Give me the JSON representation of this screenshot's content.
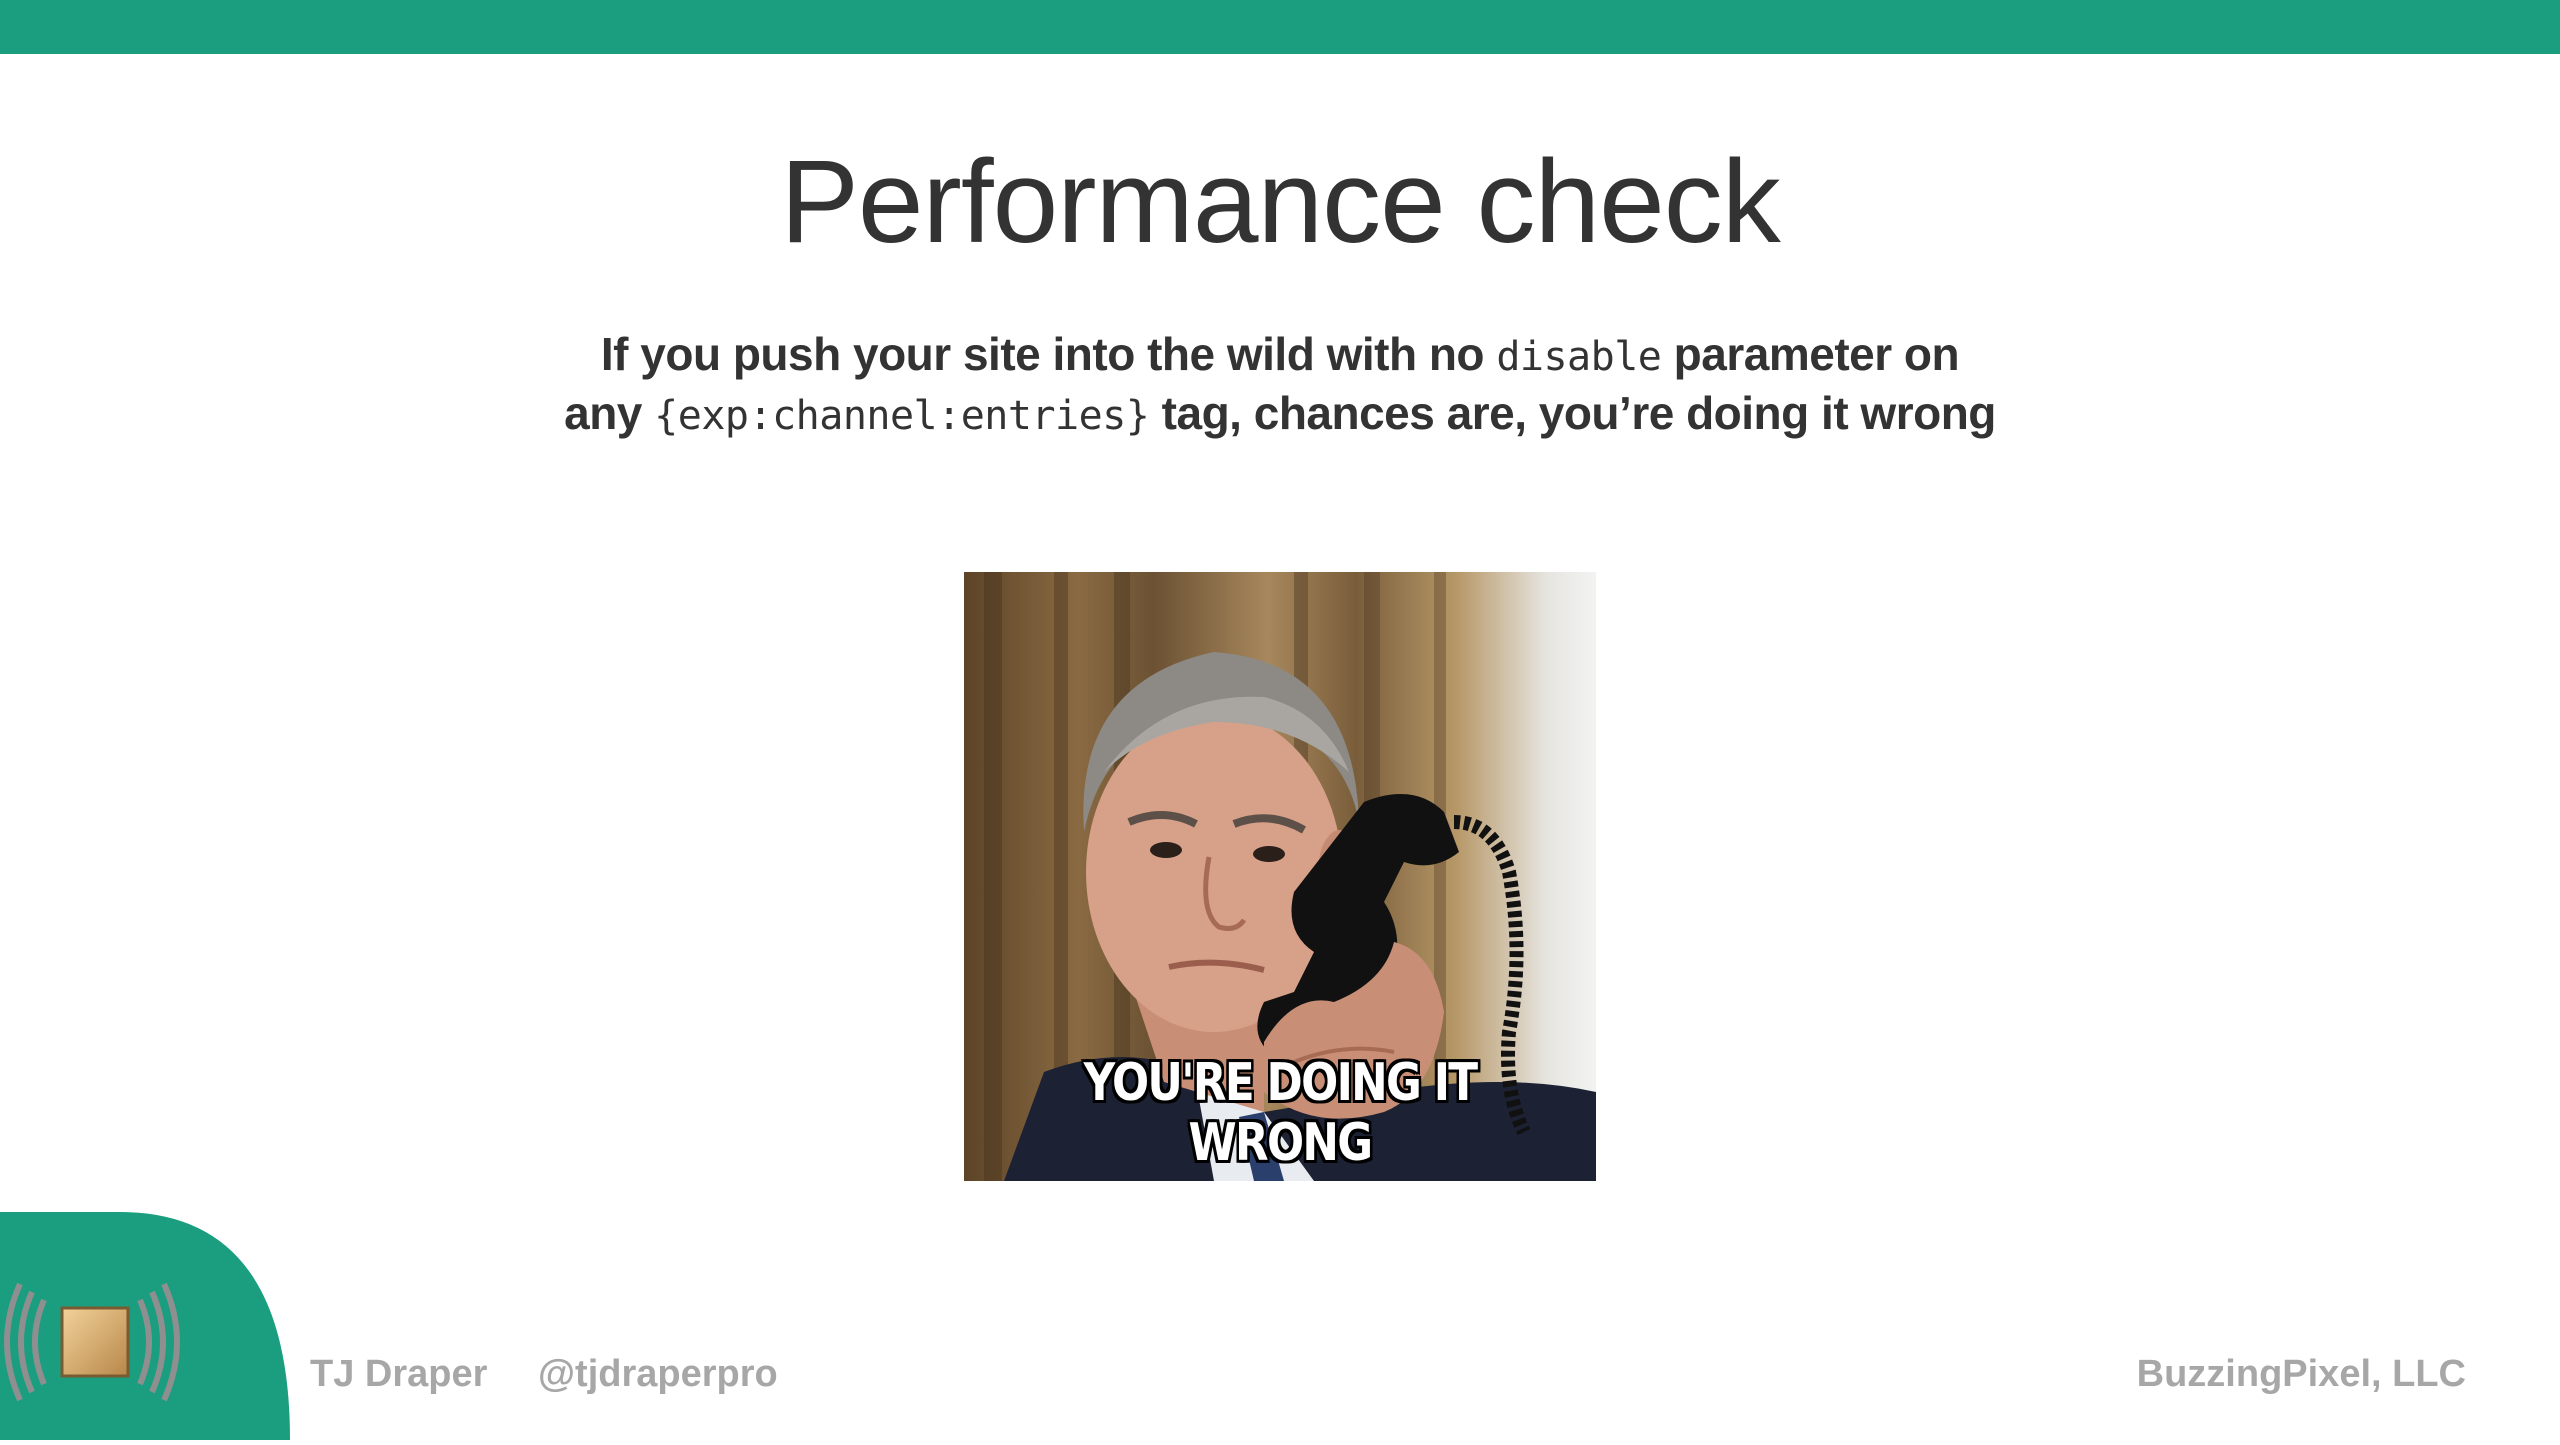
{
  "slide": {
    "title": "Performance check",
    "subtitle": {
      "line1_before": "If you push your site into the wild with no ",
      "line1_code": "disable",
      "line1_after": " parameter on",
      "line2_before": "any ",
      "line2_code": "{exp:channel:entries}",
      "line2_after": " tag, chances are, you’re doing it wrong"
    },
    "meme": {
      "caption": "YOU'RE DOING IT WRONG"
    }
  },
  "footer": {
    "presenter": "TJ Draper",
    "handle": "@tjdraperpro",
    "company": "BuzzingPixel, LLC"
  },
  "colors": {
    "accent": "#1a9e7f",
    "title_text": "#333333",
    "footer_text": "#a7a7a7"
  },
  "icons": {
    "logo": "buzzing-pixel-logo"
  }
}
